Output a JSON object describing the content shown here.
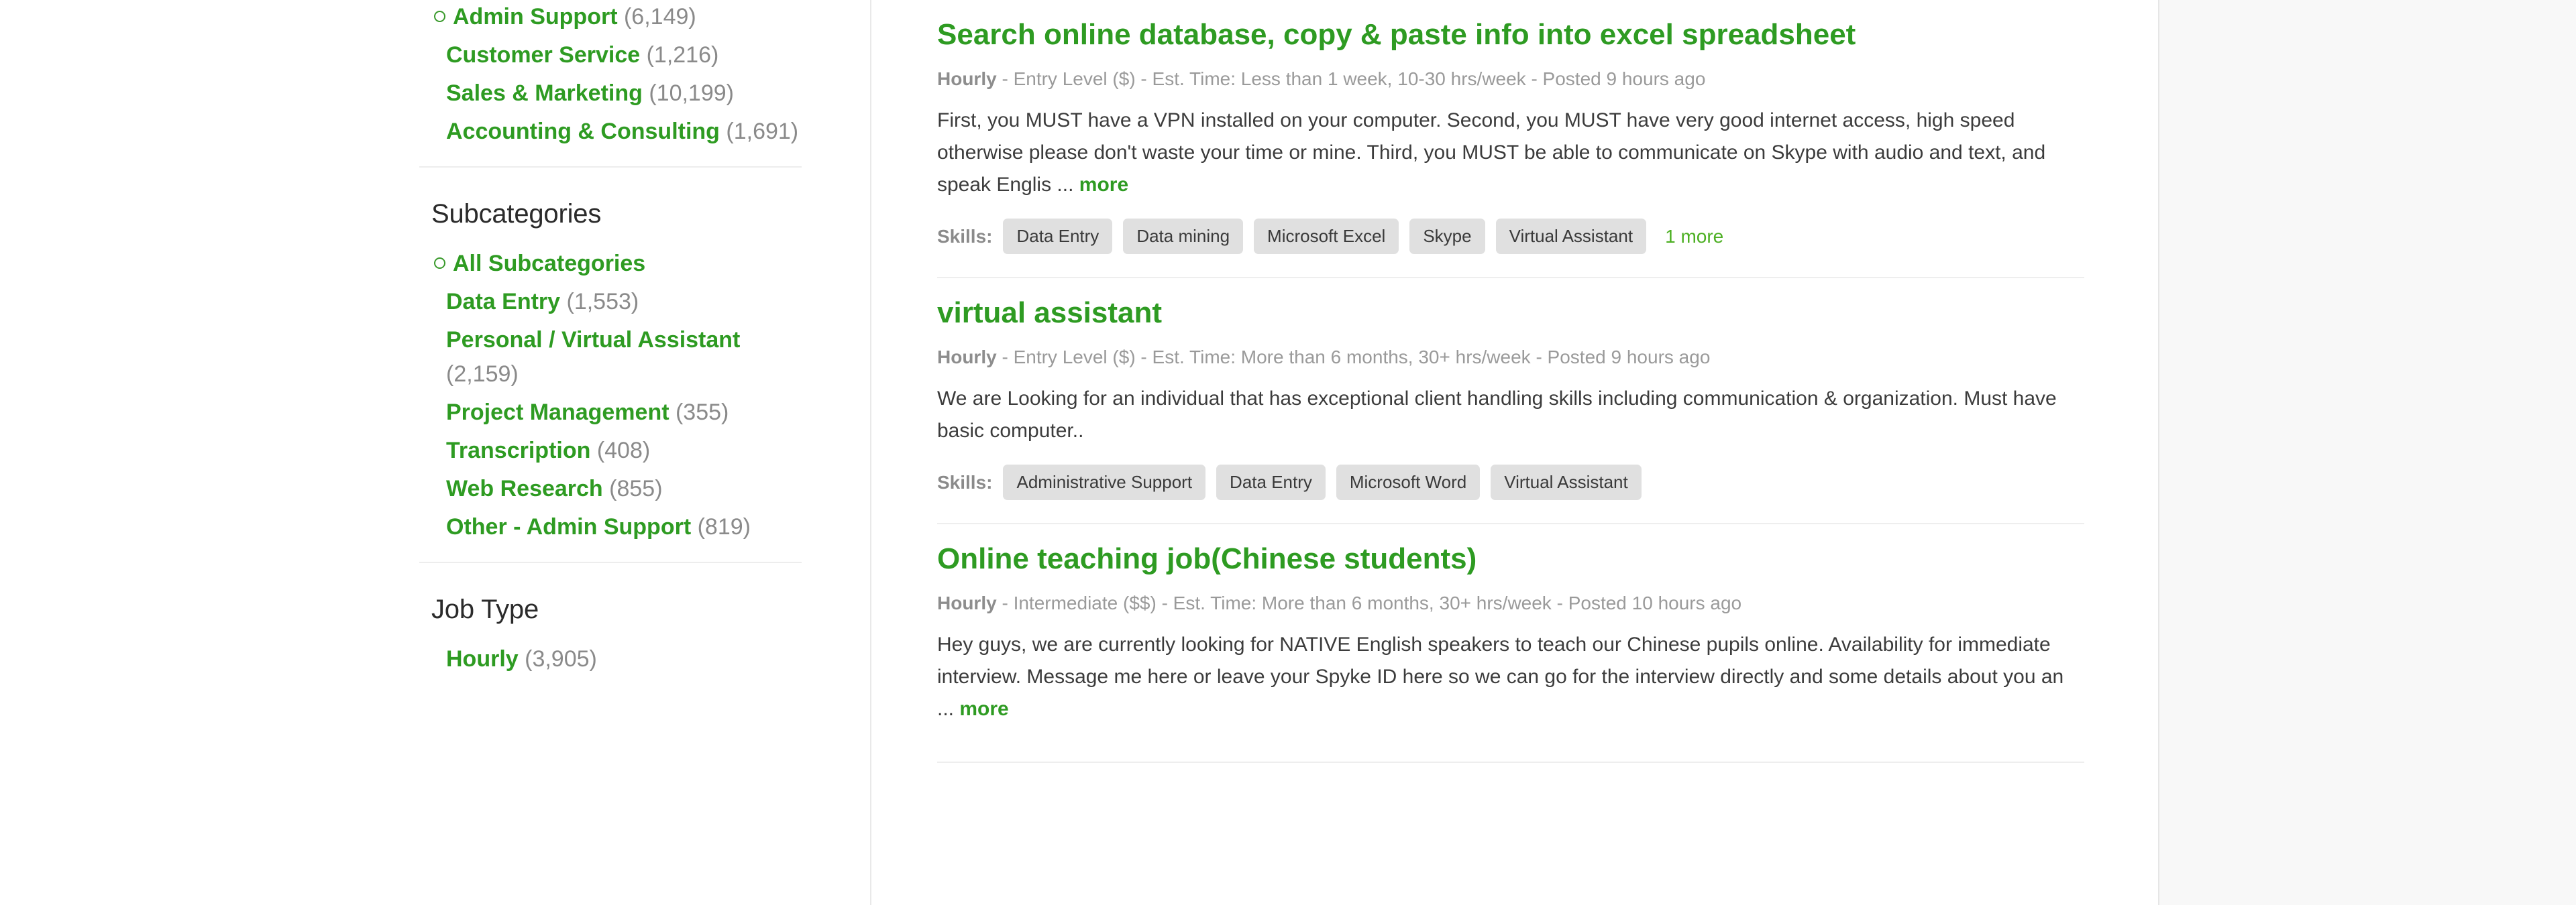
{
  "sidebar": {
    "categories": [
      {
        "label": "Admin Support",
        "count": "(6,149)",
        "selected": true
      },
      {
        "label": "Customer Service",
        "count": "(1,216)",
        "selected": false
      },
      {
        "label": "Sales & Marketing",
        "count": "(10,199)",
        "selected": false
      },
      {
        "label": "Accounting & Consulting",
        "count": "(1,691)",
        "selected": false
      }
    ],
    "subcategories_heading": "Subcategories",
    "subcategories": [
      {
        "label": "All Subcategories",
        "count": "",
        "selected": true
      },
      {
        "label": "Data Entry",
        "count": "(1,553)",
        "selected": false
      },
      {
        "label": "Personal / Virtual Assistant",
        "count": "(2,159)",
        "selected": false
      },
      {
        "label": "Project Management",
        "count": "(355)",
        "selected": false
      },
      {
        "label": "Transcription",
        "count": "(408)",
        "selected": false
      },
      {
        "label": "Web Research",
        "count": "(855)",
        "selected": false
      },
      {
        "label": "Other - Admin Support",
        "count": "(819)",
        "selected": false
      }
    ],
    "jobtype_heading": "Job Type",
    "jobtypes": [
      {
        "label": "Hourly",
        "count": "(3,905)",
        "selected": false
      }
    ]
  },
  "content": {
    "skills_label": "Skills:",
    "jobs": [
      {
        "title": "Search online database, copy & paste info into excel spreadsheet",
        "meta_strong": "Hourly",
        "meta_rest": " - Entry Level ($) - Est. Time: Less than 1 week, 10-30 hrs/week - Posted 9 hours ago",
        "description": "First, you MUST have a VPN installed on your computer. Second, you MUST have very good internet access, high speed otherwise please don't waste your time or mine. Third, you MUST be able to communicate on Skype with audio and text, and speak Englis ... ",
        "more_label": "more",
        "has_more": true,
        "skills": [
          "Data Entry",
          "Data mining",
          "Microsoft Excel",
          "Skype",
          "Virtual Assistant"
        ],
        "skills_more": "1 more"
      },
      {
        "title": "virtual assistant",
        "meta_strong": "Hourly",
        "meta_rest": " - Entry Level ($) - Est. Time: More than 6 months, 30+ hrs/week - Posted 9 hours ago",
        "description": "We are Looking for an individual that has exceptional client handling skills including communication & organization. Must have basic computer..",
        "more_label": "",
        "has_more": false,
        "skills": [
          "Administrative Support",
          "Data Entry",
          "Microsoft Word",
          "Virtual Assistant"
        ],
        "skills_more": ""
      },
      {
        "title": "Online teaching job(Chinese students)",
        "meta_strong": "Hourly",
        "meta_rest": " - Intermediate ($$) - Est. Time: More than 6 months, 30+ hrs/week - Posted 10 hours ago",
        "description": "Hey guys, we are currently looking for NATIVE English speakers to teach our Chinese pupils online. Availability for immediate interview. Message me here or leave your Spyke ID here so we can go for the interview directly and some details about you an ... ",
        "more_label": "more",
        "has_more": true,
        "skills": [],
        "skills_more": ""
      }
    ]
  },
  "colors": {
    "link_green": "#2e9b22",
    "count_gray": "#8a8a8a",
    "meta_gray": "#9a9a9a",
    "tag_bg": "#e0e0e0",
    "divider": "#eeeeee"
  }
}
